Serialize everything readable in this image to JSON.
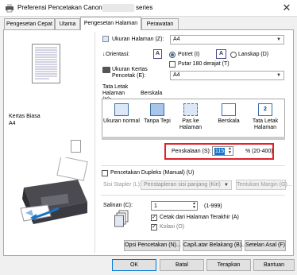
{
  "window": {
    "title": "Preferensi Pencetakan Canon",
    "title_suffix": "series",
    "close_glyph": "✕"
  },
  "tabs": [
    {
      "label": "Pengesetan Cepat"
    },
    {
      "label": "Utama"
    },
    {
      "label": "Pengesetan Halaman"
    },
    {
      "label": "Perawatan"
    }
  ],
  "active_tab": "Pengesetan Halaman",
  "preview": {
    "media_line1": "Kertas Biasa",
    "media_line2": "A4"
  },
  "page_size": {
    "label": "Ukuran Halaman (Z):",
    "value": "A4"
  },
  "orientation": {
    "label": "Orientasi:",
    "portrait_label": "Potret (I)",
    "landscape_label": "Lanskap (D)",
    "selected": "Potret (I)",
    "rotate_label": "Putar 180 derajat (T)",
    "rotate_checked": false
  },
  "paper_size": {
    "label": "Ukuran Kertas Pencetak (E):",
    "value": "A4"
  },
  "layout": {
    "label": "Tata Letak Halaman (Y):",
    "selected": "Berskala",
    "items": [
      {
        "label": "Ukuran normal",
        "icon": "page-normal-icon"
      },
      {
        "label": "Tanpa Tepi",
        "icon": "page-borderless-icon"
      },
      {
        "label": "Pas ke Halaman",
        "icon": "fit-to-page-icon"
      },
      {
        "label": "Berskala",
        "icon": "scaled-icon"
      },
      {
        "label": "Tata Letak Halaman",
        "icon": "page-layout-icon"
      }
    ]
  },
  "scaling": {
    "label": "Penskalaan (S):",
    "value": "115",
    "unit": "% (20-400)",
    "highlight_color": "#e0202a"
  },
  "duplex": {
    "label": "Pencetakan Dupleks (Manual) (U)",
    "checked": false,
    "stapling_label": "Sisi Stapler (L):",
    "stapling_value": "Penstapleran sisi panjang (Kiri)",
    "margin_button": "Tentukan Margin (G)..."
  },
  "copies": {
    "label": "Salinan (C):",
    "value": "1",
    "range": "(1-999)",
    "reverse_label": "Cetak dari Halaman Terakhir (A)",
    "reverse_checked": true,
    "collate_label": "Kolasi (O)",
    "collate_checked": true
  },
  "buttons": {
    "print_options": "Opsi Pencetakan (N)...",
    "stamp": "Cap/Latar Belakang (B)...",
    "defaults": "Setelan Asal (F)",
    "ok": "OK",
    "cancel": "Batal",
    "apply": "Terapkan",
    "help": "Bantuan"
  }
}
